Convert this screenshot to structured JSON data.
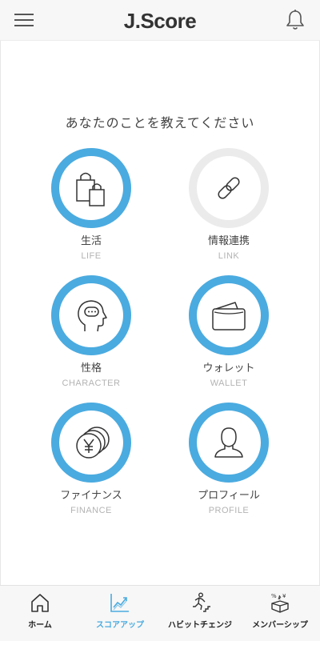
{
  "header": {
    "title": "J.Score"
  },
  "prompt": "あなたのことを教えてください",
  "categories": [
    {
      "label": "生活",
      "sub": "LIFE",
      "progress": 1.0
    },
    {
      "label": "情報連携",
      "sub": "LINK",
      "progress": 0.0
    },
    {
      "label": "性格",
      "sub": "CHARACTER",
      "progress": 1.0
    },
    {
      "label": "ウォレット",
      "sub": "WALLET",
      "progress": 1.0
    },
    {
      "label": "ファイナンス",
      "sub": "FINANCE",
      "progress": 1.0
    },
    {
      "label": "プロフィール",
      "sub": "PROFILE",
      "progress": 1.0
    }
  ],
  "tabs": [
    {
      "label": "ホーム",
      "icon": "home-icon"
    },
    {
      "label": "スコアアップ",
      "icon": "score-chart-icon",
      "active": true
    },
    {
      "label": "ハビットチェンジ",
      "icon": "habit-runner-icon"
    },
    {
      "label": "メンバーシップ",
      "icon": "membership-gift-icon"
    }
  ],
  "colors": {
    "accent": "#4aabe0",
    "ring_empty": "#ebebeb"
  }
}
